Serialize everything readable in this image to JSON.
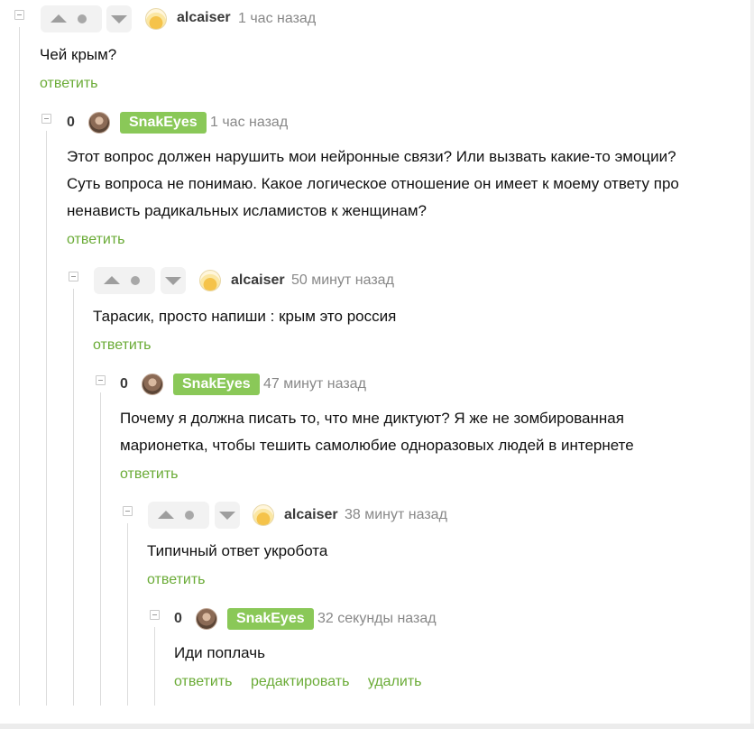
{
  "comments": [
    {
      "username": "alcaiser",
      "time": "1 час назад",
      "text": "Чей крым?",
      "actions": [
        "ответить"
      ]
    },
    {
      "rating": "0",
      "username": "SnakEyes",
      "time": "1 час назад",
      "text_lines": [
        "Этот вопрос должен нарушить мои нейронные связи? Или вызвать какие-то эмоции?",
        "Суть вопроса не понимаю. Какое логическое отношение он имеет к моему ответу про",
        "ненависть радикальных исламистов к женщинам?"
      ],
      "actions": [
        "ответить"
      ]
    },
    {
      "username": "alcaiser",
      "time": "50 минут назад",
      "text": "Тарасик, просто напиши : крым это россия",
      "actions": [
        "ответить"
      ]
    },
    {
      "rating": "0",
      "username": "SnakEyes",
      "time": "47 минут назад",
      "text_lines": [
        "Почему я должна писать то, что мне диктуют? Я же не зомбированная",
        "марионетка, чтобы тешить самолюбие одноразовых людей в интернете"
      ],
      "actions": [
        "ответить"
      ]
    },
    {
      "username": "alcaiser",
      "time": "38 минут назад",
      "text": "Типичный ответ укробота",
      "actions": [
        "ответить"
      ]
    },
    {
      "rating": "0",
      "username": "SnakEyes",
      "time": "32 секунды назад",
      "text": "Иди поплачь",
      "actions": [
        "ответить",
        "редактировать",
        "удалить"
      ]
    }
  ],
  "colors": {
    "link_green": "#6aab36",
    "badge_green": "#8ac858",
    "meta_gray": "#888888"
  },
  "icons": {
    "collapse": "minus-square-icon",
    "upvote": "arrow-up-icon",
    "downvote": "arrow-down-icon",
    "rating_dot": "dot-icon"
  }
}
